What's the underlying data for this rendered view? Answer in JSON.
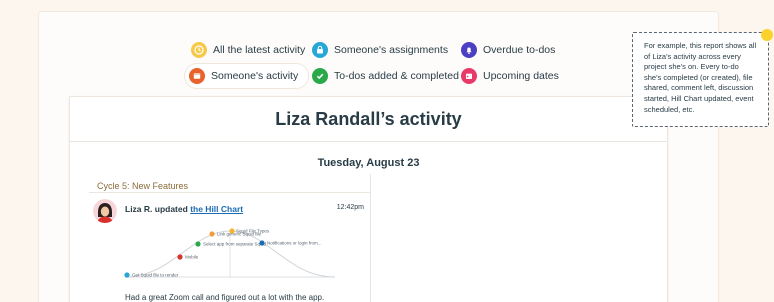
{
  "reports": [
    {
      "label": "All the latest activity",
      "icon": "clock-icon",
      "color": "#f7c948"
    },
    {
      "label": "Someone's assignments",
      "icon": "lock-person-icon",
      "color": "#27a6d8"
    },
    {
      "label": "Overdue to-dos",
      "icon": "bell-icon",
      "color": "#4b3fc4"
    },
    {
      "label": "Someone's activity",
      "icon": "calendar-card-icon",
      "color": "#e8632b"
    },
    {
      "label": "To-dos added & completed",
      "icon": "checkmark-icon",
      "color": "#2ba84a"
    },
    {
      "label": "Upcoming dates",
      "icon": "calendar-icon",
      "color": "#e83a69"
    }
  ],
  "report": {
    "title": "Liza Randall’s activity",
    "date": "Tuesday, August 23",
    "bucket": "Cycle 5: New Features",
    "event": {
      "actor": "Liza R. updated",
      "link": "the Hill Chart",
      "time": "12:42pm",
      "comment": "Had a great Zoom call and figured out a lot with the app."
    },
    "hill_points": [
      {
        "label": "Squid File Types",
        "color": "#f7b32b"
      },
      {
        "label": "Link generic Squid file",
        "color": "#f39c3d"
      },
      {
        "label": "Select app from separate Squid",
        "color": "#2ba84a"
      },
      {
        "label": "Mobile",
        "color": "#d9342b"
      },
      {
        "label": "Notifications or login from...",
        "color": "#1b6bb5"
      },
      {
        "label": "Get Squid file to render",
        "color": "#27a6d8"
      }
    ]
  },
  "callout": {
    "text": "For example, this report shows all of Liza's activity across every project she's on. Every to-do she's completed (or created), file shared, comment left, discussion started, Hill Chart updated, event scheduled, etc."
  }
}
